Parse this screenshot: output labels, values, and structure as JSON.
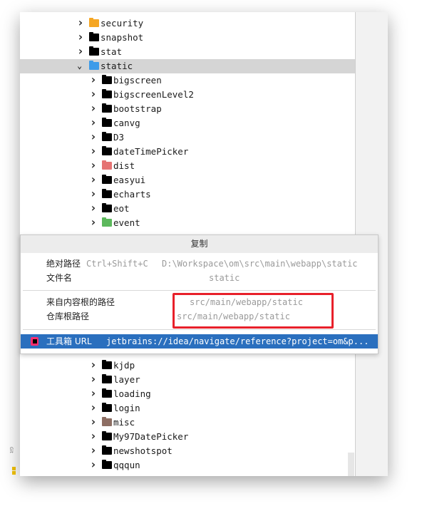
{
  "tree": {
    "top_items": [
      {
        "label": "security",
        "icon": "folder-lock-icon",
        "color": "#f5a623"
      },
      {
        "label": "snapshot",
        "icon": "folder-icon",
        "color": "#000000"
      },
      {
        "label": "stat",
        "icon": "folder-icon",
        "color": "#000000"
      },
      {
        "label": "static",
        "icon": "folder-web-icon",
        "color": "#3d9be9",
        "expanded": true,
        "selected": true
      }
    ],
    "children_a": [
      {
        "label": "bigscreen",
        "color": "#000000"
      },
      {
        "label": "bigscreenLevel2",
        "color": "#000000"
      },
      {
        "label": "bootstrap",
        "color": "#000000"
      },
      {
        "label": "canvg",
        "color": "#000000"
      },
      {
        "label": "D3",
        "color": "#000000"
      },
      {
        "label": "dateTimePicker",
        "color": "#000000"
      },
      {
        "label": "dist",
        "color": "#e57373"
      },
      {
        "label": "easyui",
        "color": "#000000"
      },
      {
        "label": "echarts",
        "color": "#000000"
      },
      {
        "label": "eot",
        "color": "#000000"
      },
      {
        "label": "event",
        "color": "#5cb85c"
      }
    ],
    "children_b": [
      {
        "label": "kjdp",
        "color": "#000000"
      },
      {
        "label": "layer",
        "color": "#000000"
      },
      {
        "label": "loading",
        "color": "#000000"
      },
      {
        "label": "login",
        "color": "#000000"
      },
      {
        "label": "misc",
        "color": "#8d6e63"
      },
      {
        "label": "My97DatePicker",
        "color": "#000000"
      },
      {
        "label": "newshotspot",
        "color": "#000000"
      },
      {
        "label": "qqqun",
        "color": "#000000"
      }
    ]
  },
  "side": {
    "label": "Git"
  },
  "popup": {
    "title": "复制",
    "items": [
      {
        "label": "绝对路径",
        "shortcut": "Ctrl+Shift+C",
        "value": "D:\\Workspace\\om\\src\\main\\webapp\\static"
      },
      {
        "label": "文件名",
        "value": "static"
      },
      {
        "label": "来自内容根的路径",
        "value": "src/main/webapp/static"
      },
      {
        "label": "仓库根路径",
        "value": "src/main/webapp/static"
      },
      {
        "label": "工具箱 URL",
        "value": "jetbrains://idea/navigate/reference?project=om&p...",
        "icon": "toolbox-icon",
        "selected": true
      }
    ],
    "highlight_color": "#e8202a",
    "selected_color": "#2a6fbe"
  }
}
